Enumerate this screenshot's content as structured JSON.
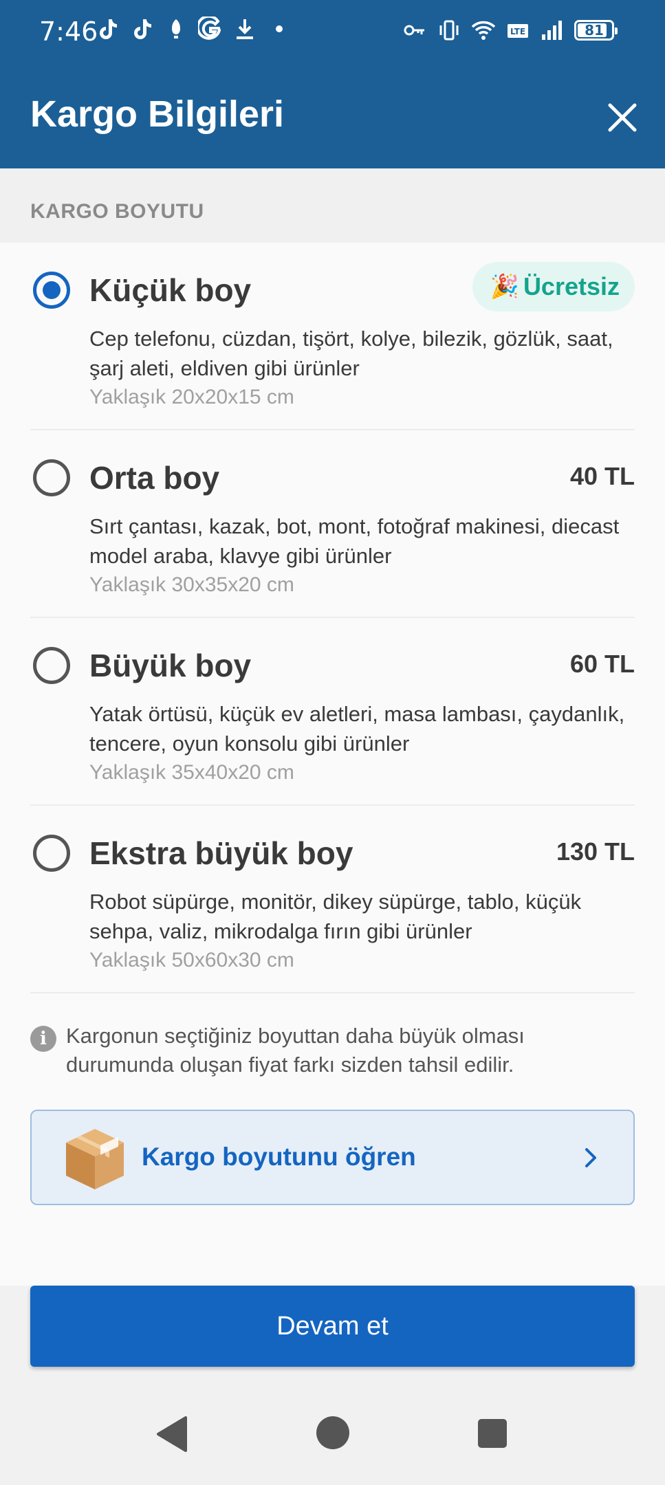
{
  "status_bar": {
    "time": "7:46",
    "left_icons": [
      "tiktok-icon",
      "tiktok-icon",
      "nuts-icon",
      "google-icon",
      "download-icon",
      "dot-icon"
    ],
    "right_icons": [
      "vpn-key-icon",
      "vibrate-icon",
      "wifi-icon",
      "lte-icon",
      "signal-icon"
    ],
    "battery": "81"
  },
  "app_bar": {
    "title": "Kargo Bilgileri",
    "close_icon": "close-icon"
  },
  "section": {
    "header": "KARGO BOYUTU"
  },
  "options": [
    {
      "title": "Küçük boy",
      "selected": true,
      "badge_emoji": "🎉",
      "badge": "Ücretsiz",
      "description": "Cep telefonu, cüzdan, tişört, kolye, bilezik, gözlük, saat, şarj aleti, eldiven gibi ürünler",
      "dimensions": "Yaklaşık 20x20x15 cm"
    },
    {
      "title": "Orta boy",
      "selected": false,
      "price": "40 TL",
      "description": "Sırt çantası, kazak, bot, mont, fotoğraf makinesi, diecast model araba, klavye gibi ürünler",
      "dimensions": "Yaklaşık 30x35x20 cm"
    },
    {
      "title": "Büyük boy",
      "selected": false,
      "price": "60 TL",
      "description": "Yatak örtüsü, küçük ev aletleri, masa lambası, çaydanlık, tencere, oyun konsolu gibi ürünler",
      "dimensions": "Yaklaşık 35x40x20 cm"
    },
    {
      "title": "Ekstra büyük boy",
      "selected": false,
      "price": "130 TL",
      "description": "Robot süpürge, monitör, dikey süpürge, tablo, küçük sehpa, valiz, mikrodalga fırın gibi ürünler",
      "dimensions": "Yaklaşık 50x60x30 cm"
    }
  ],
  "info": {
    "icon": "info-icon",
    "text": "Kargonun seçtiğiniz boyuttan daha büyük olması durumunda oluşan fiyat farkı sizden tahsil edilir."
  },
  "learn_card": {
    "icon": "package-box-icon",
    "label": "Kargo boyutunu öğren",
    "chevron": "chevron-right-icon"
  },
  "footer": {
    "continue_label": "Devam et"
  },
  "nav": {
    "back": "back-icon",
    "home": "home-icon",
    "recents": "recents-icon"
  },
  "colors": {
    "app_bar": "#1b5f96",
    "primary": "#1465c0",
    "free_badge_bg": "#e4f6f2",
    "free_badge_text": "#14a48c"
  }
}
